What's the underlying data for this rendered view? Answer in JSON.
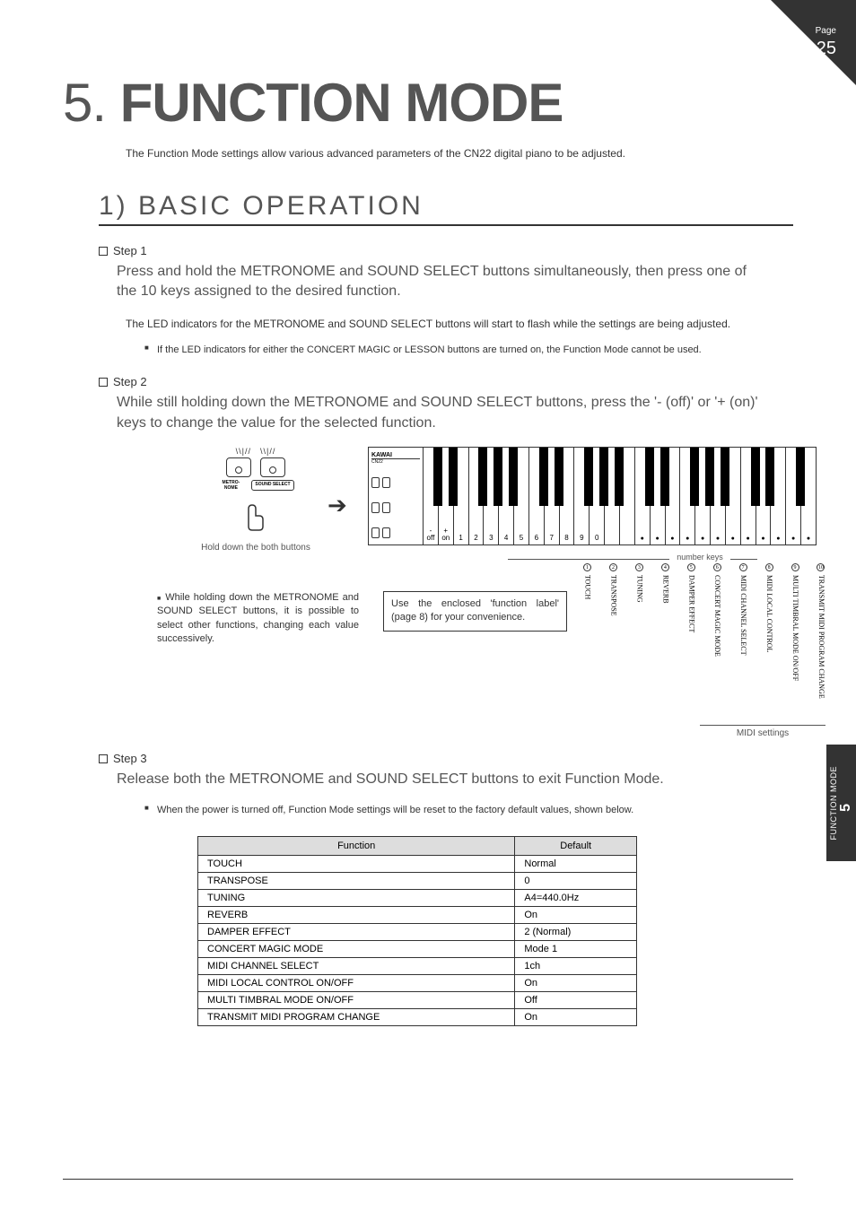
{
  "page": {
    "label": "Page",
    "number": "25"
  },
  "side_tab": {
    "num": "5",
    "text": "FUNCTION MODE"
  },
  "heading": {
    "num": "5.",
    "title": "FUNCTION MODE"
  },
  "intro": "The Function Mode settings allow various advanced parameters of the CN22 digital piano to be adjusted.",
  "section_title": "1) BASIC OPERATION",
  "step1": {
    "label": "Step 1",
    "body_large": "Press and hold the METRONOME and SOUND SELECT buttons simultaneously, then press one of the 10 keys assigned to the desired function.",
    "body_small": "The LED indicators for the METRONOME and SOUND SELECT buttons will start to flash while the settings are being adjusted.",
    "note": "If the LED indicators for either the CONCERT MAGIC or LESSON buttons are turned on, the Function Mode cannot be used."
  },
  "step2": {
    "label": "Step 2",
    "body_large": "While still holding down the METRONOME and SOUND SELECT buttons, press the '- (off)' or '+ (on)' keys to change the value for the selected function."
  },
  "diagram": {
    "btn1": "METRO-\nNOME",
    "btn2": "SOUND\nSELECT",
    "hold_caption": "Hold down the both buttons",
    "key_labels": [
      "-\noff",
      "+\non",
      "1",
      "2",
      "3",
      "4",
      "5",
      "6",
      "7",
      "8",
      "9",
      "0"
    ],
    "number_keys_label": "number keys",
    "vert_labels": [
      "TOUCH",
      "TRANSPOSE",
      "TUNING",
      "REVERB",
      "DAMPER EFFECT",
      "CONCERT MAGIC MODE",
      "MIDI CHANNEL SELECT",
      "MIDI LOCAL CONTROL",
      "MULTI TIMBRAL MODE ON/OFF",
      "TRANSMIT MIDI PROGRAM CHANGE"
    ],
    "vert_nums": [
      "1",
      "2",
      "3",
      "4",
      "5",
      "6",
      "7",
      "8",
      "9",
      "10"
    ],
    "hold_note": "While holding down the METRONOME and SOUND SELECT buttons, it is possible to select other functions, changing each value successively.",
    "label_note": "Use the enclosed 'function label' (page 8) for your convenience.",
    "midi_bracket": "MIDI settings",
    "kb_logo": "KAWAI",
    "kb_model": "CN22"
  },
  "step3": {
    "label": "Step 3",
    "body_large": "Release both the METRONOME and SOUND SELECT buttons to exit Function Mode.",
    "note": "When the power is turned off, Function Mode settings will be reset to the factory default values, shown below."
  },
  "defaults": {
    "headers": [
      "Function",
      "Default"
    ],
    "rows": [
      [
        "TOUCH",
        "Normal"
      ],
      [
        "TRANSPOSE",
        "0"
      ],
      [
        "TUNING",
        "A4=440.0Hz"
      ],
      [
        "REVERB",
        "On"
      ],
      [
        "DAMPER EFFECT",
        "2 (Normal)"
      ],
      [
        "CONCERT MAGIC MODE",
        "Mode 1"
      ],
      [
        "MIDI CHANNEL SELECT",
        "1ch"
      ],
      [
        "MIDI LOCAL CONTROL ON/OFF",
        "On"
      ],
      [
        "MULTI TIMBRAL MODE ON/OFF",
        "Off"
      ],
      [
        "TRANSMIT MIDI PROGRAM CHANGE",
        "On"
      ]
    ]
  }
}
